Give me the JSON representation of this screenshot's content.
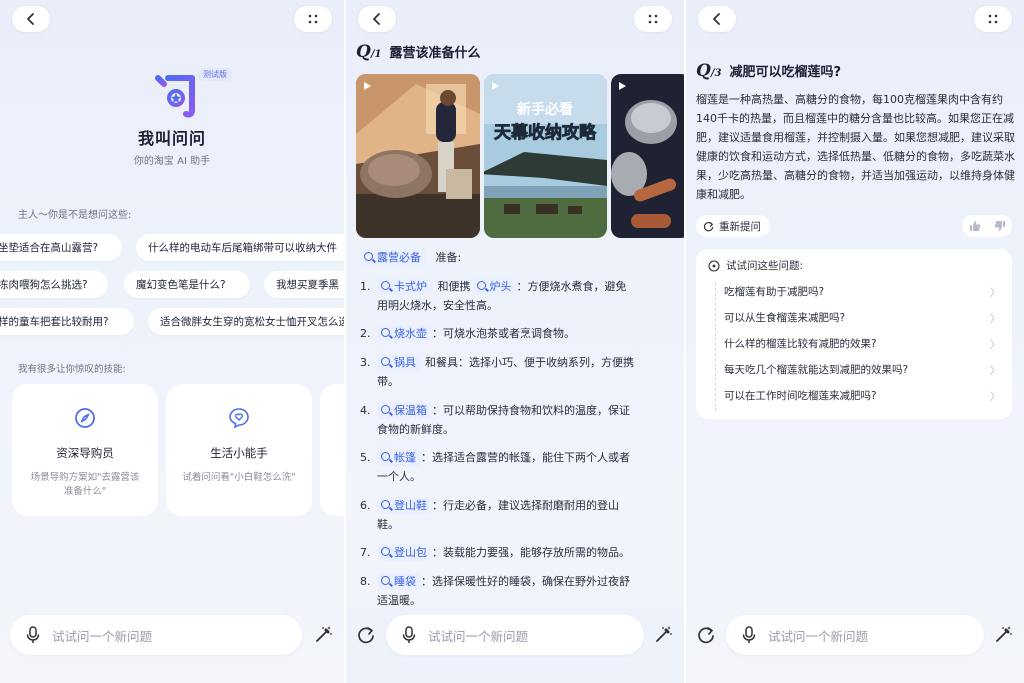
{
  "panel1": {
    "beta": "测试版",
    "brand_name": "我叫问问",
    "brand_sub": "你的淘宝 AI 助手",
    "prompt": "主人～你是不是想问这些:",
    "chips_row1": [
      "坐垫适合在高山露营?",
      "什么样的电动车后尾箱绑带可以收纳大件"
    ],
    "chips_row2": [
      "冻肉喂狗怎么挑选?",
      "魔幻变色笔是什么?",
      "我想买夏季黑"
    ],
    "chips_row3": [
      "样的童车把套比较耐用?",
      "适合微胖女生穿的宽松女士恤开叉怎么选"
    ],
    "skills_title": "我有很多让你惊叹的技能:",
    "skills": [
      {
        "name": "资深导购员",
        "desc": "场景导购方案如\"去露营该准备什么\""
      },
      {
        "name": "生活小能手",
        "desc": "试着问问看\"小白鞋怎么洗\""
      }
    ],
    "input_placeholder": "试试问一个新问题"
  },
  "panel2": {
    "q_prefix": "Q",
    "q_index": "/1",
    "question": "露营该准备什么",
    "thumb2_line1": "新手必看",
    "thumb2_line2": "天幕收纳攻略",
    "intro_tag": "露营必备",
    "intro_after": "准备:",
    "items": [
      {
        "n": "1.",
        "tag": "卡式炉",
        "mid": "和便携",
        "tag2": "炉头",
        "text": "：方便烧水煮食，避免",
        "cont": "用明火烧水，安全性高。"
      },
      {
        "n": "2.",
        "tag": "烧水壶",
        "text": "：可烧水泡茶或者烹调食物。"
      },
      {
        "n": "3.",
        "tag": "锅具",
        "text": "和餐具：选择小巧、便于收纳系列，方便携",
        "cont": "带。"
      },
      {
        "n": "4.",
        "tag": "保温箱",
        "text": "：可以帮助保持食物和饮料的温度，保证",
        "cont": "食物的新鲜度。"
      },
      {
        "n": "5.",
        "tag": "帐篷",
        "text": "：选择适合露营的帐篷，能住下两个人或者",
        "cont": "一个人。"
      },
      {
        "n": "6.",
        "tag": "登山鞋",
        "text": "：行走必备，建议选择耐磨耐用的登山",
        "cont": "鞋。"
      },
      {
        "n": "7.",
        "tag": "登山包",
        "text": "：装载能力要强，能够存放所需的物品。"
      },
      {
        "n": "8.",
        "tag": "睡袋",
        "text": "：选择保暖性好的睡袋，确保在野外过夜舒",
        "cont": "适温暖。"
      }
    ],
    "input_placeholder": "试试问一个新问题"
  },
  "panel3": {
    "q_prefix": "Q",
    "q_index": "/3",
    "question": "减肥可以吃榴莲吗?",
    "answer": "榴莲是一种高热量、高糖分的食物，每100克榴莲果肉中含有约140千卡的热量，而且榴莲中的糖分含量也比较高。如果您正在减肥，建议适量食用榴莲，并控制摄入量。如果您想减肥，建议采取健康的饮食和运动方式，选择低热量、低糖分的食物，多吃蔬菜水果，少吃高热量、高糖分的食物，并适当加强运动，以维持身体健康和减肥。",
    "retry": "重新提问",
    "sugg_title": "试试问这些问题:",
    "suggestions": [
      "吃榴莲有助于减肥吗?",
      "可以从生食榴莲来减肥吗?",
      "什么样的榴莲比较有减肥的效果?",
      "每天吃几个榴莲就能达到减肥的效果吗?",
      "可以在工作时间吃榴莲来减肥吗?"
    ],
    "input_placeholder": "试试问一个新问题"
  },
  "colors": {
    "accent": "#3a63e6",
    "tag_bg": "#eaf0ff",
    "brand_gradient_start": "#4f6df0",
    "brand_gradient_end": "#8a5cf0"
  },
  "icons": [
    "back-icon",
    "more-icon",
    "mic-icon",
    "magic-wand-icon",
    "refresh-icon",
    "compass-icon",
    "heart-bubble-icon",
    "search-tag-icon",
    "play-icon",
    "thumb-up-icon",
    "thumb-down-icon",
    "chevron-right-icon",
    "question-circle-icon"
  ]
}
